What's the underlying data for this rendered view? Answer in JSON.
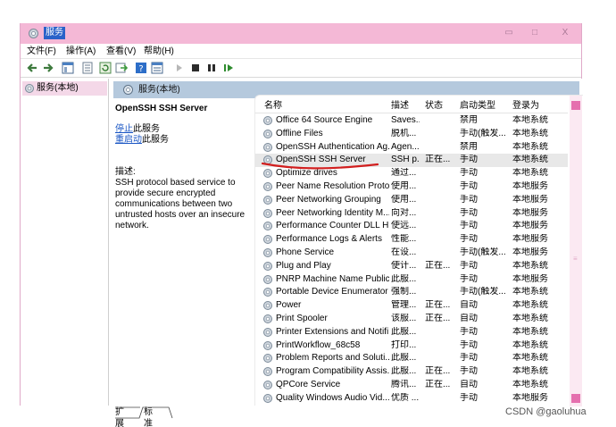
{
  "window": {
    "title": "服务",
    "buttons": {
      "minimize": "▭",
      "maximize": "□",
      "close": "X"
    }
  },
  "menu": [
    "文件(F)",
    "操作(A)",
    "查看(V)",
    "帮助(H)"
  ],
  "toolbar": {
    "icons": [
      "back-icon",
      "forward-icon",
      "console-tree-icon",
      "properties-icon",
      "refresh-icon",
      "export-icon",
      "help-icon",
      "view-icon",
      "start-icon",
      "stop-icon",
      "pause-icon",
      "restart-icon"
    ]
  },
  "left_pane": {
    "item": "服务(本地)"
  },
  "services_header": "服务(本地)",
  "detail": {
    "title": "OpenSSH SSH Server",
    "stop_link": "停止",
    "stop_suffix": "此服务",
    "restart_link": "重启动",
    "restart_suffix": "此服务",
    "desc_label": "描述:",
    "description": "SSH protocol based service to provide secure encrypted communications between two untrusted hosts over an insecure network."
  },
  "table": {
    "columns": [
      "名称",
      "描述",
      "状态",
      "启动类型",
      "登录为"
    ],
    "rows": [
      {
        "name": "Office 64 Source Engine",
        "desc": "Saves...",
        "status": "",
        "startup": "禁用",
        "logon": "本地系统"
      },
      {
        "name": "Offline Files",
        "desc": "脱机...",
        "status": "",
        "startup": "手动(触发...",
        "logon": "本地系统"
      },
      {
        "name": "OpenSSH Authentication Ag...",
        "desc": "Agen...",
        "status": "",
        "startup": "禁用",
        "logon": "本地系统"
      },
      {
        "name": "OpenSSH SSH Server",
        "desc": "SSH p...",
        "status": "正在...",
        "startup": "手动",
        "logon": "本地系统"
      },
      {
        "name": "Optimize drives",
        "desc": "通过...",
        "status": "",
        "startup": "手动",
        "logon": "本地系统"
      },
      {
        "name": "Peer Name Resolution Proto...",
        "desc": "使用...",
        "status": "",
        "startup": "手动",
        "logon": "本地服务"
      },
      {
        "name": "Peer Networking Grouping",
        "desc": "使用...",
        "status": "",
        "startup": "手动",
        "logon": "本地服务"
      },
      {
        "name": "Peer Networking Identity M...",
        "desc": "向对...",
        "status": "",
        "startup": "手动",
        "logon": "本地服务"
      },
      {
        "name": "Performance Counter DLL H...",
        "desc": "使远...",
        "status": "",
        "startup": "手动",
        "logon": "本地服务"
      },
      {
        "name": "Performance Logs & Alerts",
        "desc": "性能...",
        "status": "",
        "startup": "手动",
        "logon": "本地服务"
      },
      {
        "name": "Phone Service",
        "desc": "在设...",
        "status": "",
        "startup": "手动(触发...",
        "logon": "本地服务"
      },
      {
        "name": "Plug and Play",
        "desc": "使计...",
        "status": "正在...",
        "startup": "手动",
        "logon": "本地系统"
      },
      {
        "name": "PNRP Machine Name Public...",
        "desc": "此服...",
        "status": "",
        "startup": "手动",
        "logon": "本地服务"
      },
      {
        "name": "Portable Device Enumerator ...",
        "desc": "强制...",
        "status": "",
        "startup": "手动(触发...",
        "logon": "本地系统"
      },
      {
        "name": "Power",
        "desc": "管理...",
        "status": "正在...",
        "startup": "自动",
        "logon": "本地系统"
      },
      {
        "name": "Print Spooler",
        "desc": "该服...",
        "status": "正在...",
        "startup": "自动",
        "logon": "本地系统"
      },
      {
        "name": "Printer Extensions and Notifi...",
        "desc": "此服...",
        "status": "",
        "startup": "手动",
        "logon": "本地系统"
      },
      {
        "name": "PrintWorkflow_68c58",
        "desc": "打印...",
        "status": "",
        "startup": "手动",
        "logon": "本地系统"
      },
      {
        "name": "Problem Reports and Soluti...",
        "desc": "此服...",
        "status": "",
        "startup": "手动",
        "logon": "本地系统"
      },
      {
        "name": "Program Compatibility Assis...",
        "desc": "此服...",
        "status": "正在...",
        "startup": "手动",
        "logon": "本地系统"
      },
      {
        "name": "QPCore Service",
        "desc": "腾讯...",
        "status": "正在...",
        "startup": "自动",
        "logon": "本地系统"
      },
      {
        "name": "Quality Windows Audio Vid...",
        "desc": "优质 ...",
        "status": "",
        "startup": "手动",
        "logon": "本地服务"
      }
    ],
    "highlighted_row": 3
  },
  "tabs": [
    "扩展",
    "标准"
  ],
  "watermark": "CSDN @gaoluhua",
  "colors": {
    "titlebar": "#f4b8d6",
    "accent": "#e56fae",
    "link": "#1a56c4",
    "annotation": "#d11f1f"
  }
}
